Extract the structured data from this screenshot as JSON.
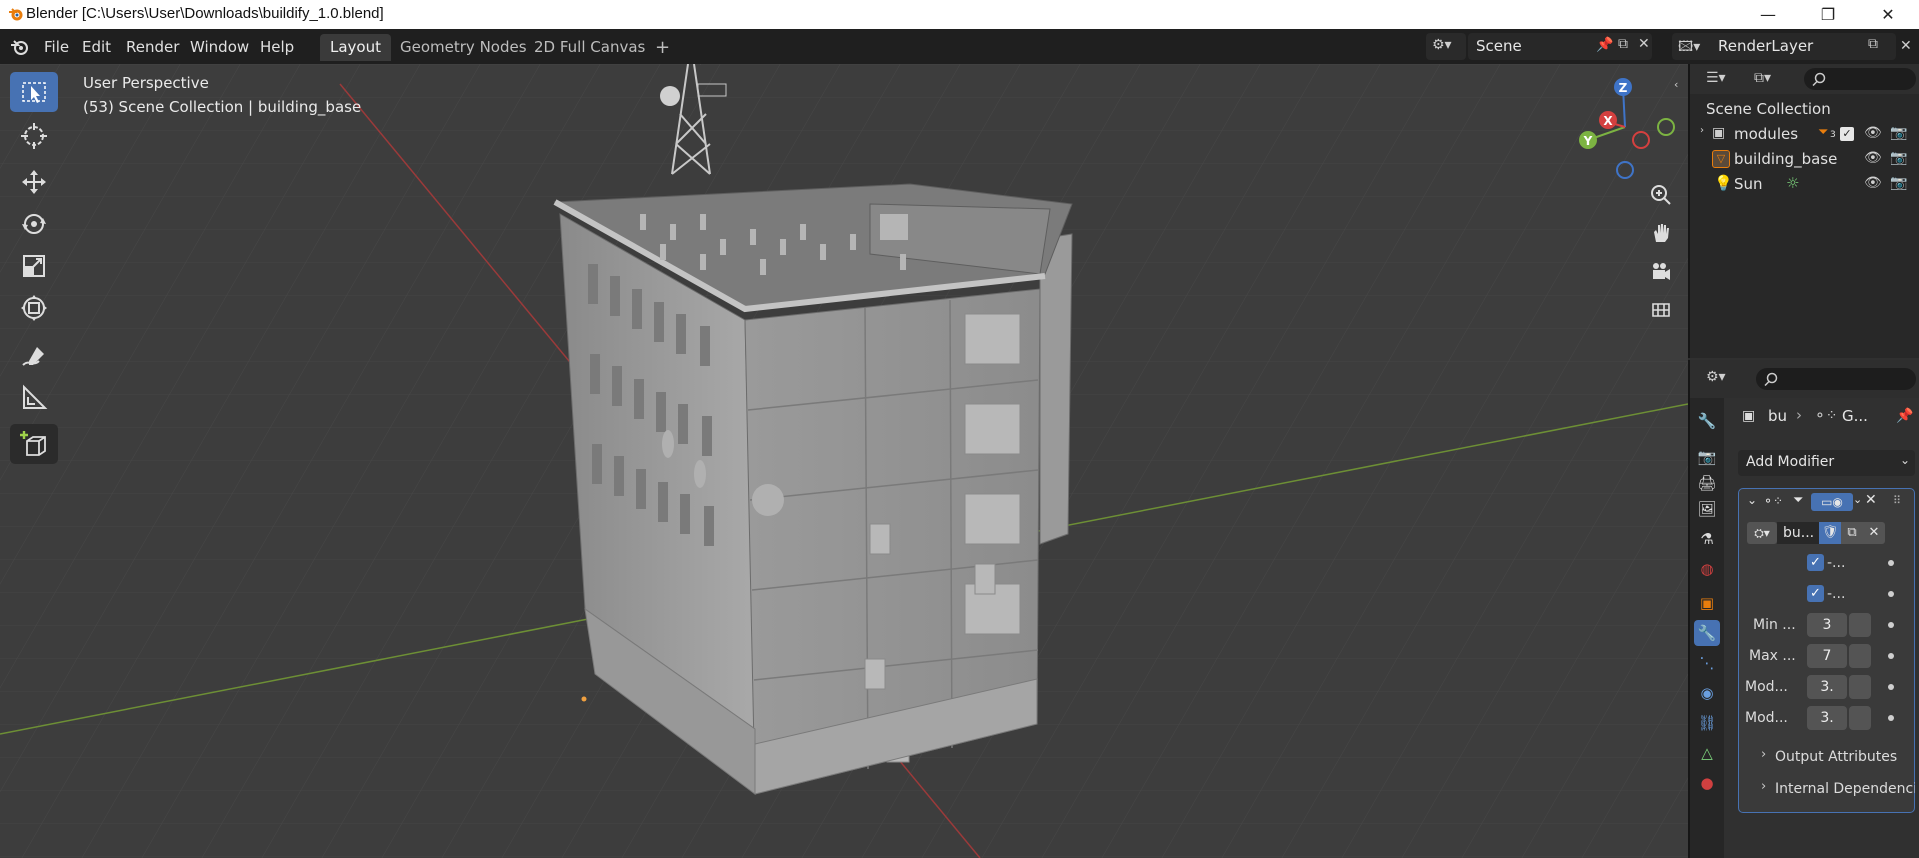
{
  "window": {
    "title": "Blender [C:\\Users\\User\\Downloads\\buildify_1.0.blend]",
    "minimize": "—",
    "maximize": "❐",
    "close": "✕"
  },
  "menu": {
    "items": [
      "File",
      "Edit",
      "Render",
      "Window",
      "Help"
    ],
    "workspaces": [
      "Layout",
      "Geometry Nodes",
      "2D Full Canvas"
    ],
    "add_tab": "+",
    "scene": "Scene",
    "render_layer": "RenderLayer"
  },
  "viewport": {
    "view_name": "User Perspective",
    "collection_info": "(53) Scene Collection | building_base",
    "gizmo": {
      "x": "X",
      "y": "Y",
      "z": "Z"
    }
  },
  "outliner": {
    "root": "Scene Collection",
    "items": [
      {
        "label": "modules",
        "badge": "3"
      },
      {
        "label": "building_base"
      },
      {
        "label": "Sun"
      }
    ]
  },
  "properties": {
    "breadcrumb_object": "bu",
    "breadcrumb_modifier": "G...",
    "add_modifier": "Add Modifier",
    "node_group": "bu...",
    "checks": [
      "-...",
      "-..."
    ],
    "fields": [
      {
        "label": "Min ...",
        "value": "3"
      },
      {
        "label": "Max ...",
        "value": "7"
      },
      {
        "label": "Mod...",
        "value": "3."
      },
      {
        "label": "Mod...",
        "value": "3."
      }
    ],
    "sections": [
      "Output Attributes",
      "Internal Dependenci"
    ]
  },
  "colors": {
    "accent": "#4772b3",
    "viewport_bg": "#3d3d3d",
    "x_axis": "#d4403f",
    "y_axis": "#7cb342",
    "z_axis": "#3f74c8"
  }
}
